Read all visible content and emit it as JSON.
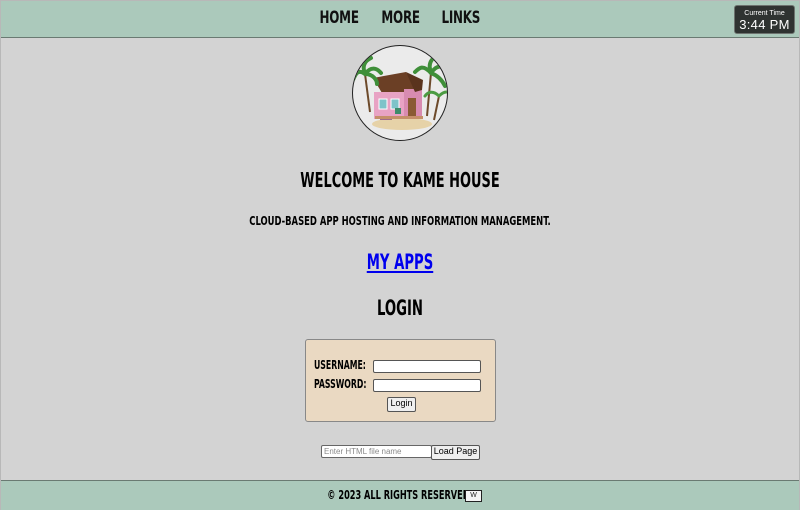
{
  "nav": {
    "items": [
      "Home",
      "More",
      "Links"
    ]
  },
  "clock": {
    "label": "Current Time",
    "time": "3:44 PM"
  },
  "logo": {
    "icon": "beach-house-icon",
    "colors": {
      "house": "#e8a3c4",
      "roof": "#6b3f25",
      "palm": "#3f8f39"
    }
  },
  "main": {
    "welcome": "Welcome to Kame House",
    "tagline": "Cloud-based app hosting and information management.",
    "apps_link": "My Apps",
    "login_heading": "Login"
  },
  "login_form": {
    "username_label": "Username:",
    "password_label": "Password:",
    "username_value": "",
    "password_value": "",
    "submit_label": "Login"
  },
  "file_loader": {
    "placeholder": "Enter HTML file name",
    "button_label": "Load Page"
  },
  "footer": {
    "copyright": "© 2023 All rights reserved.",
    "badge_text": "W"
  },
  "colors": {
    "header_bg": "#abc9bb",
    "page_bg": "#d3d3d3",
    "login_box_bg": "#ead9c2",
    "link": "#0000ee"
  }
}
